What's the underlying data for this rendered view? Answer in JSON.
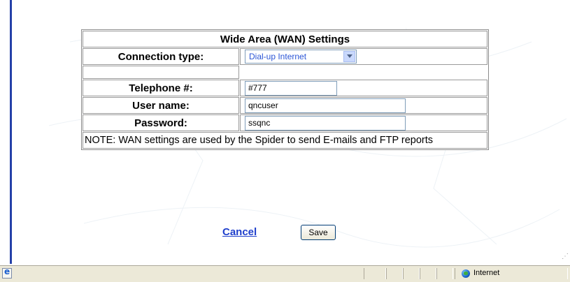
{
  "wan": {
    "title": "Wide Area (WAN) Settings",
    "connection_type_label": "Connection type:",
    "connection_type_value": "Dial-up Internet",
    "telephone_label": "Telephone #:",
    "telephone_value": "#777",
    "username_label": "User name:",
    "username_value": "qncuser",
    "password_label": "Password:",
    "password_value": "ssqnc",
    "note": "NOTE: WAN settings are used by the Spider to send E-mails and FTP reports"
  },
  "actions": {
    "cancel_label": "Cancel",
    "save_label": "Save"
  },
  "status_bar": {
    "zone_label": "Internet"
  },
  "icons": {
    "page": "ie-page-icon",
    "zone": "globe-icon",
    "dropdown": "chevron-down-icon"
  },
  "colors": {
    "link": "#1f3fcc",
    "left_rule": "#2440a8",
    "status_bar": "#ece9d8",
    "select_text": "#2b55d6"
  }
}
